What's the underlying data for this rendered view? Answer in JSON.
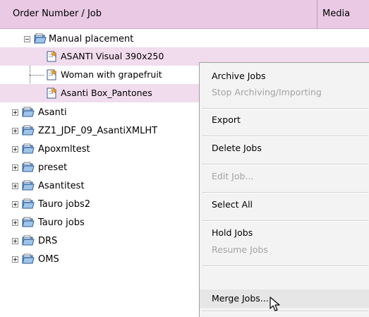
{
  "header": {
    "col_order": "Order Number / Job",
    "col_media": "Media"
  },
  "tree": {
    "group": {
      "label": "Manual placement",
      "expanded": true
    },
    "children": [
      {
        "label": "ASANTI Visual 390x250",
        "selected": true
      },
      {
        "label": "Woman with grapefruit",
        "selected": false
      },
      {
        "label": "Asanti Box_Pantones",
        "selected": true
      }
    ],
    "folders": [
      "Asanti",
      "ZZ1_JDF_09_AsantiXMLHT",
      "Apoxmltest",
      "preset",
      "Asantitest",
      "Tauro jobs2",
      "Tauro jobs",
      "DRS",
      "OMS"
    ]
  },
  "context_menu": {
    "items": [
      {
        "label": "Archive Jobs",
        "enabled": true
      },
      {
        "label": "Stop Archiving/Importing",
        "enabled": false
      },
      {
        "label": "Export",
        "enabled": true
      },
      {
        "label": "Delete Jobs",
        "enabled": true
      },
      {
        "label": "Edit Job...",
        "enabled": false
      },
      {
        "label": "Select All",
        "enabled": true
      },
      {
        "label": "Hold Jobs",
        "enabled": true
      },
      {
        "label": "Resume Jobs",
        "enabled": false
      },
      {
        "label": "Merge Jobs...",
        "enabled": true,
        "hovered": true
      }
    ]
  },
  "colors": {
    "header_bg": "#e9c9e4",
    "selected_row_bg": "#f1dcee",
    "menu_bg": "#f3f3f3",
    "disabled_text": "#a3a3a3"
  }
}
